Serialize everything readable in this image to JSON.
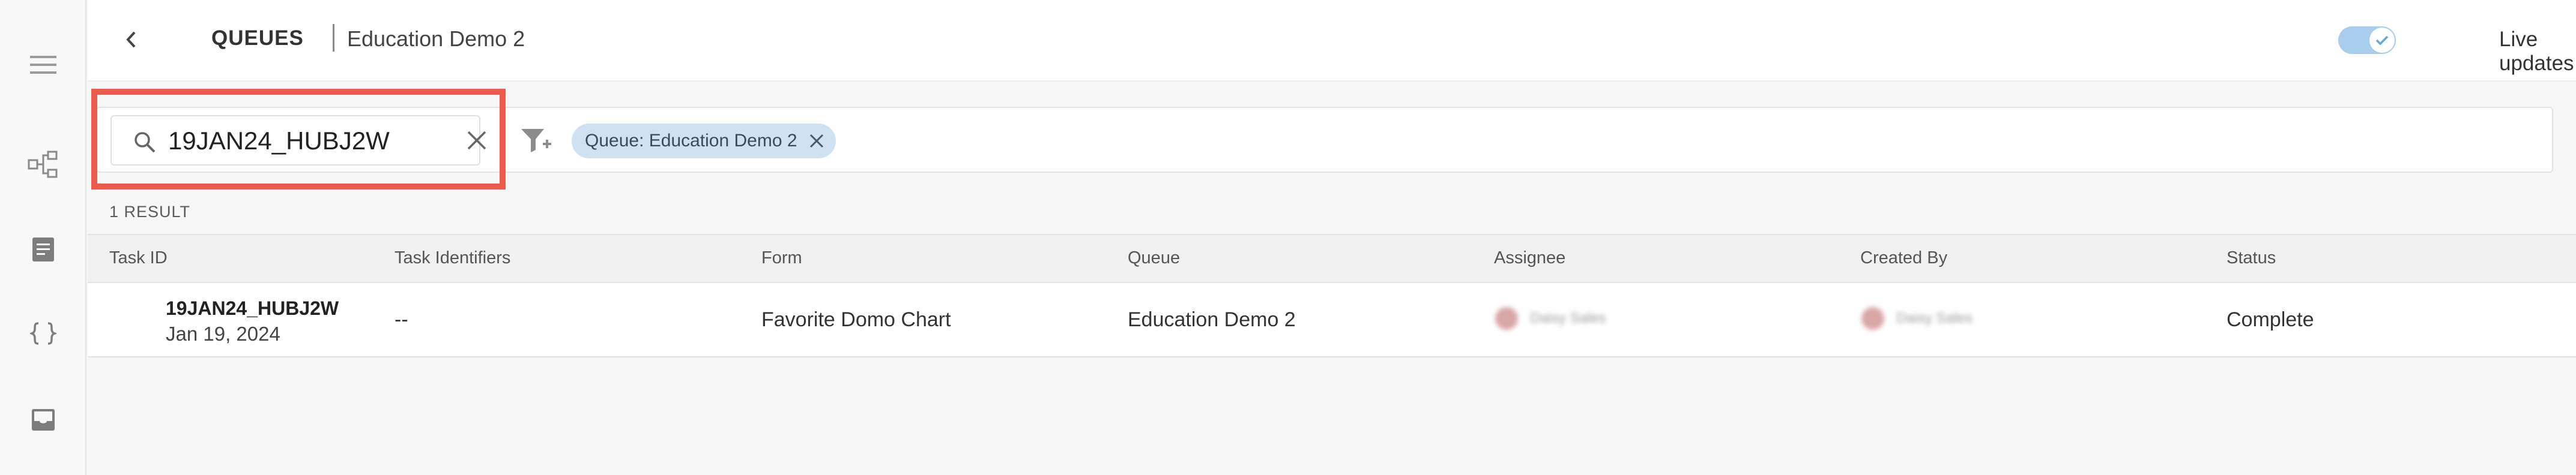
{
  "header": {
    "section": "QUEUES",
    "queue_name": "Education Demo 2",
    "live_updates_label": "Live updates",
    "live_updates_on": true
  },
  "rail": {
    "icons": [
      "menu-icon",
      "workflow-icon",
      "document-icon",
      "code-braces-icon",
      "inbox-icon"
    ]
  },
  "search": {
    "value": "19JAN24_HUBJ2W",
    "placeholder": ""
  },
  "filters": {
    "chips": [
      {
        "label": "Queue: Education Demo 2"
      }
    ]
  },
  "results": {
    "count_label": "1 RESULT"
  },
  "table": {
    "columns": [
      "Task ID",
      "Task Identifiers",
      "Form",
      "Queue",
      "Assignee",
      "Created By",
      "Status"
    ],
    "rows": [
      {
        "task_id": "19JAN24_HUBJ2W",
        "date": "Jan 19, 2024",
        "identifiers": "--",
        "form": "Favorite Domo Chart",
        "queue": "Education Demo 2",
        "assignee": "Daisy Sales",
        "created_by": "Daisy Sales",
        "status": "Complete"
      }
    ]
  },
  "colors": {
    "highlight": "#ee5a4c",
    "toggle_on": "#a9cdec",
    "chip_bg": "#cfe2f4"
  }
}
